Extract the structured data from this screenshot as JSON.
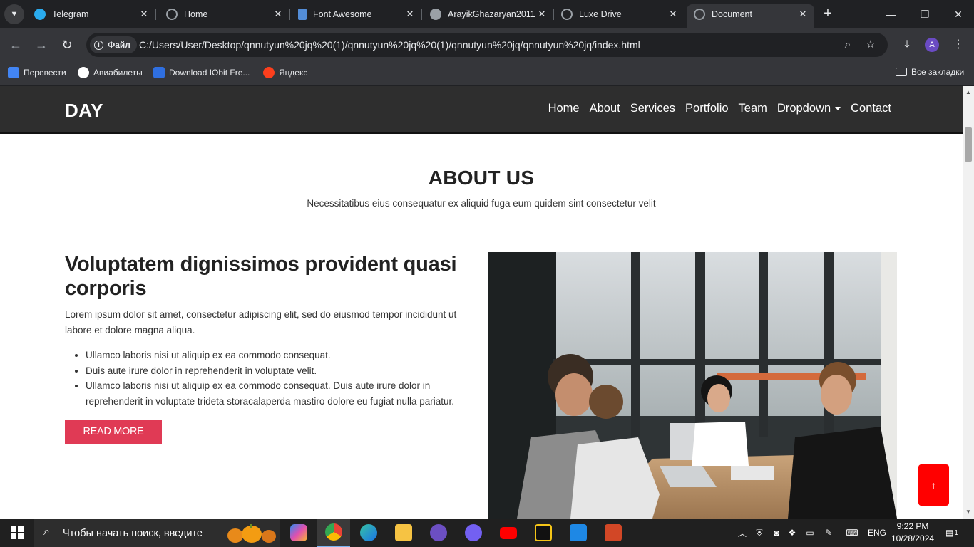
{
  "browser": {
    "tabs": [
      {
        "title": "Telegram",
        "favicon_color": "#2aabee",
        "active": false
      },
      {
        "title": "Home",
        "favicon_color": "#9aa0a6",
        "active": false
      },
      {
        "title": "Font Awesome",
        "favicon_color": "#538dd7",
        "active": false
      },
      {
        "title": "ArayikGhazaryan2011",
        "favicon_color": "#9aa0a6",
        "active": false
      },
      {
        "title": "Luxe Drive",
        "favicon_color": "#9aa0a6",
        "active": false
      },
      {
        "title": "Document",
        "favicon_color": "#9aa0a6",
        "active": true
      }
    ],
    "omnibox": {
      "chip_label": "Файл",
      "url": "C:/Users/User/Desktop/qnnutyun%20jq%20(1)/qnnutyun%20jq%20(1)/qnnutyun%20jq/qnnutyun%20jq/index.html"
    },
    "profile_initial": "A",
    "bookmarks": [
      {
        "label": "Перевести",
        "color": "#4285f4"
      },
      {
        "label": "Авиабилеты",
        "color": "#ffffff"
      },
      {
        "label": "Download IObit Fre...",
        "color": "#2f6fe0"
      },
      {
        "label": "Яндекс",
        "color": "#fc3f1d"
      }
    ],
    "all_bookmarks_label": "Все закладки"
  },
  "site": {
    "logo": "DAY",
    "nav": [
      "Home",
      "About",
      "Services",
      "Portfolio",
      "Team",
      "Dropdown",
      "Contact"
    ],
    "about": {
      "title": "ABOUT US",
      "subtitle": "Necessitatibus eius consequatur ex aliquid fuga eum quidem sint consectetur velit",
      "heading": "Voluptatem dignissimos provident quasi corporis",
      "paragraph": "Lorem ipsum dolor sit amet, consectetur adipiscing elit, sed do eiusmod tempor incididunt ut labore et dolore magna aliqua.",
      "bullets": [
        "Ullamco laboris nisi ut aliquip ex ea commodo consequat.",
        "Duis aute irure dolor in reprehenderit in voluptate velit.",
        "Ullamco laboris nisi ut aliquip ex ea commodo consequat. Duis aute irure dolor in reprehenderit in voluptate trideta storacalaperda mastiro dolore eu fugiat nulla pariatur."
      ],
      "button": "READ MORE",
      "accent": "#e03a55"
    },
    "back_to_top": "↑",
    "back_to_top_color": "#ff0000"
  },
  "taskbar": {
    "search_placeholder": "Чтобы начать поиск, введите",
    "apps": [
      "copilot-icon",
      "chrome-icon",
      "edge-icon",
      "file-explorer-icon",
      "app-icon",
      "viber-icon",
      "youtube-icon",
      "media-player-icon",
      "vscode-icon",
      "powerpoint-icon"
    ],
    "language": "ENG",
    "time": "9:22 PM",
    "date": "10/28/2024",
    "notification_count": "1"
  }
}
